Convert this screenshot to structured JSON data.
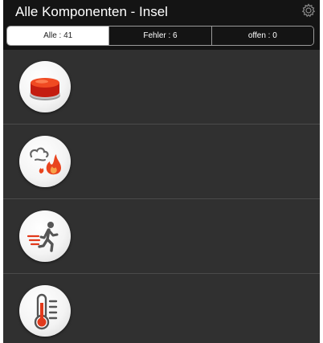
{
  "header": {
    "title": "Alle Komponenten - Insel",
    "settings_icon": "gear-icon"
  },
  "tabs": [
    {
      "label": "Alle : 41",
      "active": true
    },
    {
      "label": "Fehler : 6",
      "active": false
    },
    {
      "label": "offen : 0",
      "active": false
    }
  ],
  "components": [
    {
      "icon": "alarm-button-icon"
    },
    {
      "icon": "smoke-fire-detector-icon"
    },
    {
      "icon": "motion-sensor-icon"
    },
    {
      "icon": "thermometer-icon"
    }
  ],
  "colors": {
    "header_bg": "#141414",
    "list_bg": "#303030",
    "accent_red": "#e23a1c"
  }
}
